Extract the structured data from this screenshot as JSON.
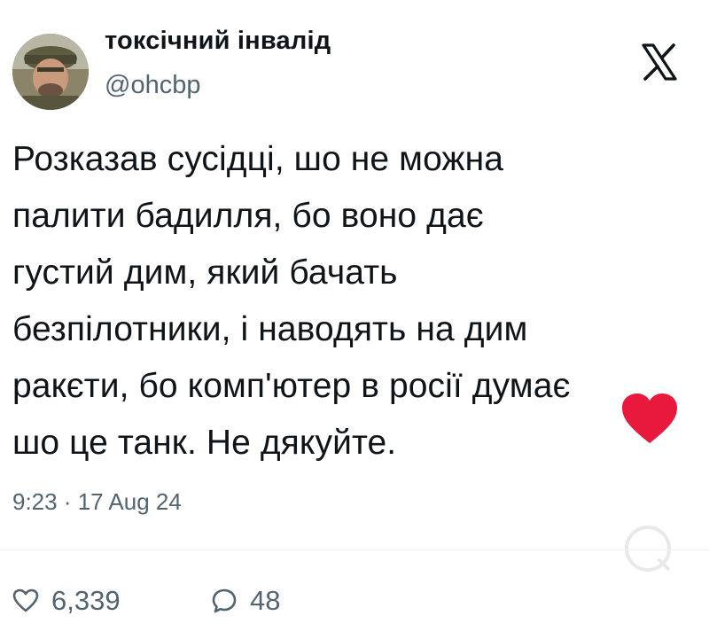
{
  "author": {
    "display_name": "токсічний інвалід",
    "handle": "@ohcbp"
  },
  "icons": {
    "platform_logo": "x-logo-icon",
    "like": "heart-outline-icon",
    "reply": "speech-bubble-icon",
    "reaction": "red-heart-icon",
    "faded_overlay": "magnifier-circle-icon"
  },
  "tweet": {
    "text": "Розказав сусідці, шо не можна\nпалити бадилля, бо воно дає\nгустий дим, який бачать\nбезпілотники, і наводять на дим\nракєти, бо комп'ютер в росії думає\nшо це танк. Не дякуйте.",
    "timestamp": "9:23 · 17 Aug 24"
  },
  "metrics": {
    "likes": "6,339",
    "replies": "48"
  },
  "colors": {
    "text": "#0f1419",
    "secondary": "#536471",
    "heart_red": "#e8193c"
  }
}
